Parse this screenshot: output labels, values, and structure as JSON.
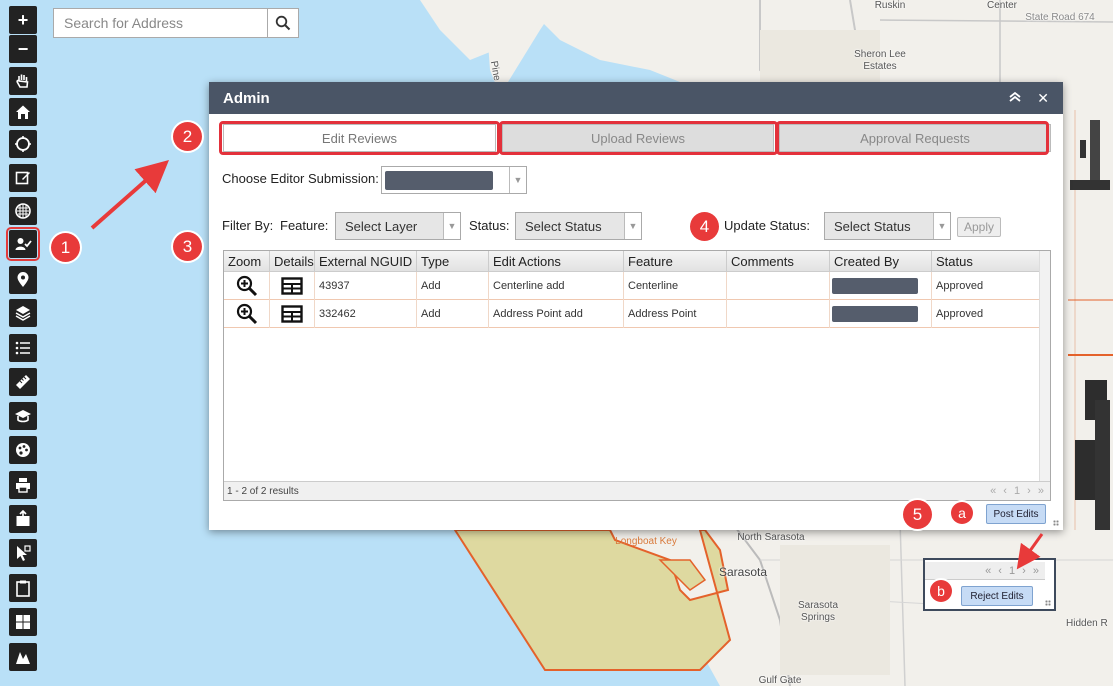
{
  "search": {
    "placeholder": "Search for Address"
  },
  "toolbar": {
    "items": [
      {
        "name": "zoom-in",
        "glyph": "+"
      },
      {
        "name": "zoom-out",
        "glyph": "−"
      },
      {
        "name": "pan",
        "glyph": "hand"
      },
      {
        "name": "home",
        "glyph": "home"
      },
      {
        "name": "locate",
        "glyph": "crosshair"
      },
      {
        "name": "edit",
        "glyph": "edit"
      },
      {
        "name": "basemap",
        "glyph": "grid"
      },
      {
        "name": "admin",
        "glyph": "user-check"
      },
      {
        "name": "marker",
        "glyph": "eye-pin"
      },
      {
        "name": "layers",
        "glyph": "layers"
      },
      {
        "name": "legend",
        "glyph": "list"
      },
      {
        "name": "measure",
        "glyph": "ruler"
      },
      {
        "name": "identify",
        "glyph": "cap"
      },
      {
        "name": "visibility",
        "glyph": "eye"
      },
      {
        "name": "print",
        "glyph": "print"
      },
      {
        "name": "export",
        "glyph": "export"
      },
      {
        "name": "select",
        "glyph": "select"
      },
      {
        "name": "clipboard",
        "glyph": "clipboard"
      },
      {
        "name": "widgets",
        "glyph": "tiles"
      },
      {
        "name": "draw",
        "glyph": "draw"
      }
    ]
  },
  "map_labels": {
    "ruskin": "Ruskin",
    "center": "Center",
    "state_road": "State Road 674",
    "sheron_lee": "Sheron Lee\nEstates",
    "pine": "Pine",
    "north_sarasota": "North Sarasota",
    "sarasota": "Sarasota",
    "sarasota_springs": "Sarasota\nSprings",
    "longboat_key": "Longboat Key",
    "gulf_gate": "Gulf Gate",
    "hidden": "Hidden R"
  },
  "admin": {
    "title": "Admin",
    "collapse_icon": "chevron-double-up",
    "close_glyph": "✕",
    "tabs": [
      "Edit Reviews",
      "Upload Reviews",
      "Approval Requests"
    ],
    "active_tab": 0,
    "choose_label": "Choose Editor Submission:",
    "filter_by_label": "Filter By:",
    "feature_label": "Feature:",
    "feature_select": "Select Layer",
    "status_label": "Status:",
    "status_select": "Select Status",
    "update_status_label": "Update Status:",
    "update_status_select": "Select Status",
    "apply_label": "Apply",
    "grid": {
      "columns": [
        "Zoom",
        "Details",
        "External NGUID",
        "Type",
        "Edit Actions",
        "Feature",
        "Comments",
        "Created By",
        "Status"
      ],
      "rows": [
        {
          "nguid": "43937",
          "type": "Add",
          "action": "Centerline add",
          "feature": "Centerline",
          "comments": "",
          "status": "Approved"
        },
        {
          "nguid": "332462",
          "type": "Add",
          "action": "Address Point add",
          "feature": "Address Point",
          "comments": "",
          "status": "Approved"
        }
      ],
      "footer": "1 - 2 of 2 results",
      "pager": "« ‹ 1 › »"
    },
    "post_edits_label": "Post Edits"
  },
  "inset": {
    "pager": "« ‹ 1 › »",
    "reject_edits_label": "Reject Edits"
  },
  "callouts": [
    "1",
    "2",
    "3",
    "4",
    "5",
    "a",
    "b"
  ],
  "colors": {
    "water": "#b9e0f7",
    "land": "#f2f0eb",
    "header": "#4a5566",
    "callout": "#e83a3a",
    "outline": "#e3313b",
    "polygon_fill": "#ded9a0",
    "polygon_stroke": "#e4622b"
  }
}
